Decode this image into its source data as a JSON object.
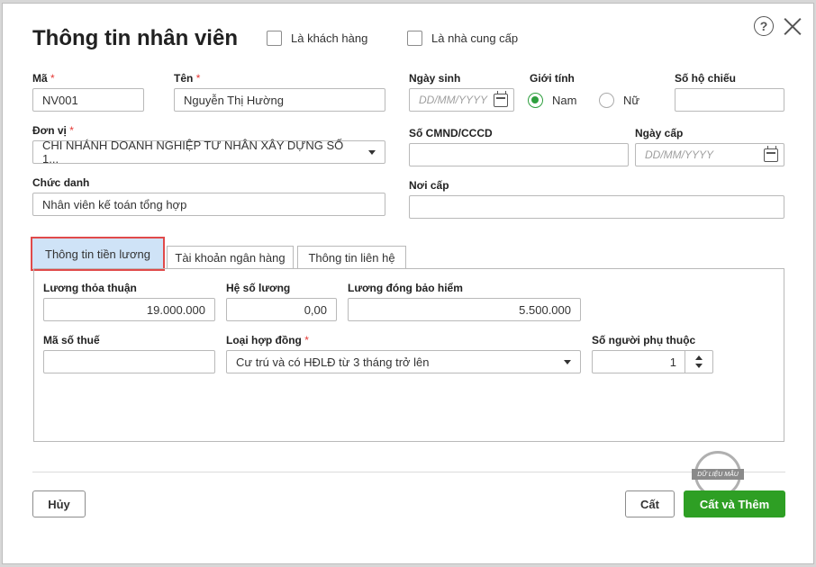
{
  "dialog": {
    "title": "Thông tin nhân viên",
    "is_customer_label": "Là khách hàng",
    "is_supplier_label": "Là nhà cung cấp",
    "help_glyph": "?"
  },
  "fields": {
    "code": {
      "label": "Mã",
      "value": "NV001"
    },
    "name": {
      "label": "Tên",
      "value": "Nguyễn Thị Hường"
    },
    "unit": {
      "label": "Đơn vị",
      "value": "CHI NHÁNH DOANH NGHIỆP TƯ NHÂN XÂY DỰNG SỐ 1..."
    },
    "position": {
      "label": "Chức danh",
      "value": "Nhân viên kế toán tổng hợp"
    },
    "birthday": {
      "label": "Ngày sinh",
      "placeholder": "DD/MM/YYYY"
    },
    "gender": {
      "label": "Giới tính",
      "options": [
        "Nam",
        "Nữ"
      ],
      "selected": "Nam"
    },
    "passport": {
      "label": "Số hộ chiếu",
      "value": ""
    },
    "id_number": {
      "label": "Số CMND/CCCD",
      "value": ""
    },
    "issue_date": {
      "label": "Ngày cấp",
      "placeholder": "DD/MM/YYYY"
    },
    "issue_place": {
      "label": "Nơi cấp",
      "value": ""
    }
  },
  "tabs": [
    {
      "label": "Thông tin tiền lương",
      "active": true
    },
    {
      "label": "Tài khoản ngân hàng",
      "active": false
    },
    {
      "label": "Thông tin liên hệ",
      "active": false
    }
  ],
  "salary": {
    "agreed_salary": {
      "label": "Lương thỏa thuận",
      "value": "19.000.000"
    },
    "salary_coefficient": {
      "label": "Hệ số lương",
      "value": "0,00"
    },
    "insurance_salary": {
      "label": "Lương đóng bảo hiểm",
      "value": "5.500.000"
    },
    "tax_code": {
      "label": "Mã số thuế",
      "value": ""
    },
    "contract_type": {
      "label": "Loại hợp đồng",
      "value": "Cư trú và có HĐLĐ từ 3 tháng trở lên"
    },
    "dependents": {
      "label": "Số người phụ thuộc",
      "value": "1"
    }
  },
  "footer": {
    "cancel": "Hủy",
    "save": "Cất",
    "save_and_add": "Cất và Thêm",
    "stamp_text": "DỮ LIỆU MẪU"
  },
  "colors": {
    "accent_green": "#2e9f24",
    "required_red": "#e53935",
    "active_tab_bg": "#cfe3f7",
    "highlight_border": "#e04a4a"
  },
  "required_marker": "*"
}
